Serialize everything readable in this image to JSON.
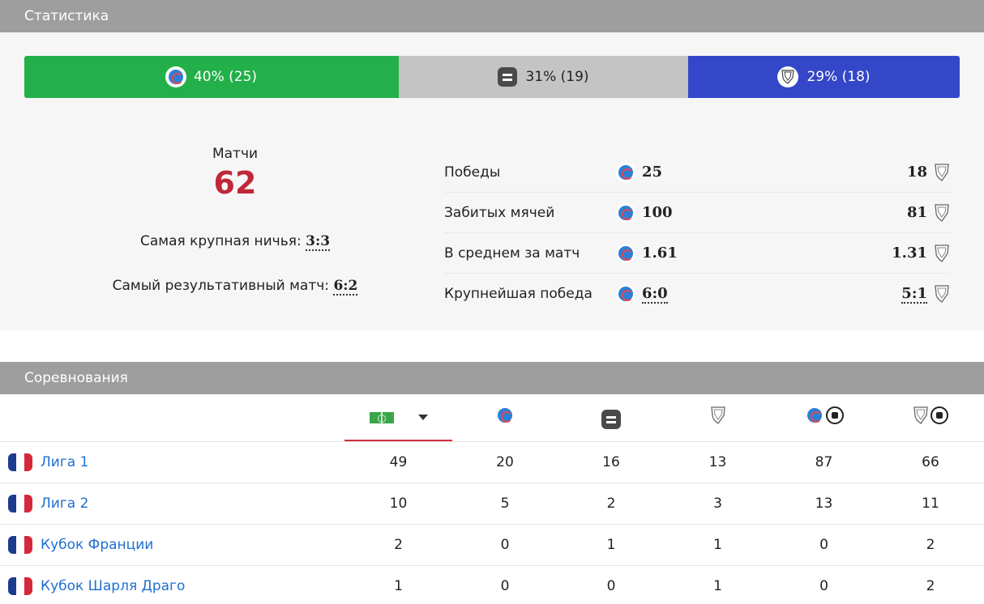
{
  "stats": {
    "header": "Статистика",
    "bar": {
      "home_label": "40% (25)",
      "draw_label": "31% (19)",
      "away_label": "29% (18)",
      "home_pct": 40,
      "draw_pct": 31,
      "away_pct": 29,
      "colors": {
        "home": "#23b04a",
        "draw": "#c4c4c4",
        "away": "#3447c9"
      }
    },
    "matches_label": "Матчи",
    "matches_value": "62",
    "biggest_draw_label": "Самая крупная ничья:",
    "biggest_draw_value": "3:3",
    "most_goals_label": "Самый результативный матч:",
    "most_goals_value": "6:2",
    "rows": [
      {
        "label": "Победы",
        "home": "25",
        "away": "18"
      },
      {
        "label": "Забитых мячей",
        "home": "100",
        "away": "81"
      },
      {
        "label": "В среднем за матч",
        "home": "1.61",
        "away": "1.31"
      },
      {
        "label": "Крупнейшая победа",
        "home": "6:0",
        "away": "5:1"
      }
    ]
  },
  "competitions": {
    "header": "Соревнования",
    "columns": [
      "matches-pitch-icon",
      "home-wins-logo",
      "draws-icon",
      "away-wins-logo",
      "home-goals-icon",
      "away-goals-icon"
    ],
    "rows": [
      {
        "name": "Лига 1",
        "matches": "49",
        "home_wins": "20",
        "draws": "16",
        "away_wins": "13",
        "home_goals": "87",
        "away_goals": "66"
      },
      {
        "name": "Лига 2",
        "matches": "10",
        "home_wins": "5",
        "draws": "2",
        "away_wins": "3",
        "home_goals": "13",
        "away_goals": "11"
      },
      {
        "name": "Кубок Франции",
        "matches": "2",
        "home_wins": "0",
        "draws": "1",
        "away_wins": "1",
        "home_goals": "0",
        "away_goals": "2"
      },
      {
        "name": "Кубок Шарля Драго",
        "matches": "1",
        "home_wins": "0",
        "draws": "0",
        "away_wins": "1",
        "home_goals": "0",
        "away_goals": "2"
      }
    ]
  }
}
